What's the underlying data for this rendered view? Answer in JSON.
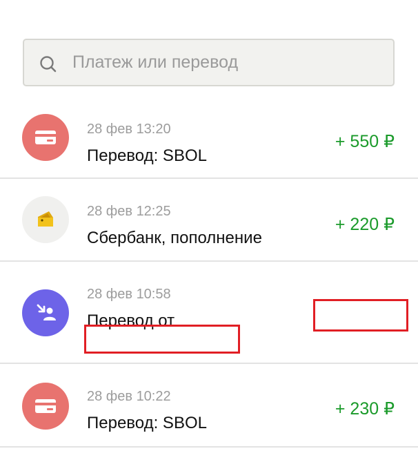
{
  "search": {
    "placeholder": "Платеж или перевод",
    "icon": "search-icon"
  },
  "colors": {
    "card_icon_bg": "#e8736f",
    "sber_icon_bg": "#f0f0ee",
    "sber_icon_fg": "#f2c21b",
    "transfer_icon_bg": "#6d63e8",
    "amount_positive": "#1a9a2a",
    "redaction": "#e11e24"
  },
  "transactions": [
    {
      "icon": "card-icon",
      "date": "28 фев 13:20",
      "title": "Перевод: SBOL",
      "amount": "+ 550 ₽"
    },
    {
      "icon": "wallet-icon",
      "date": "28 фев 12:25",
      "title": "Сбербанк, пополнение",
      "amount": "+ 220 ₽"
    },
    {
      "icon": "incoming-transfer-icon",
      "date": "28 фев 10:58",
      "title": "Перевод от",
      "amount": ""
    },
    {
      "icon": "card-icon",
      "date": "28 фев 10:22",
      "title": "Перевод: SBOL",
      "amount": "+ 230 ₽"
    }
  ]
}
